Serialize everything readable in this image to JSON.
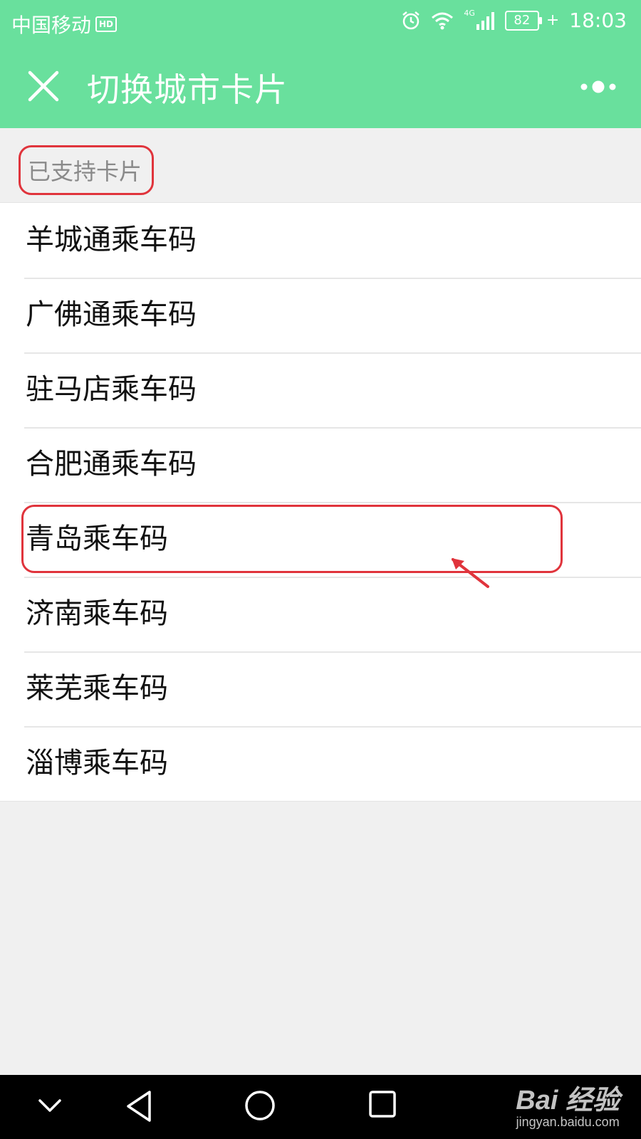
{
  "status_bar": {
    "carrier": "中国移动",
    "carrier_badge": "HD",
    "network": "4G",
    "battery": "82",
    "time": "18:03"
  },
  "header": {
    "title": "切换城市卡片",
    "close_icon": "close-icon",
    "more_icon": "more-icon"
  },
  "section": {
    "label": "已支持卡片"
  },
  "cards": [
    {
      "label": "羊城通乘车码"
    },
    {
      "label": "广佛通乘车码"
    },
    {
      "label": "驻马店乘车码"
    },
    {
      "label": "合肥通乘车码"
    },
    {
      "label": "青岛乘车码"
    },
    {
      "label": "济南乘车码"
    },
    {
      "label": "莱芜乘车码"
    },
    {
      "label": "淄博乘车码"
    }
  ],
  "annotation_color": "#e0343c",
  "header_color": "#69e09d",
  "watermark": {
    "logo": "Bai 经验",
    "url": "jingyan.baidu.com"
  }
}
